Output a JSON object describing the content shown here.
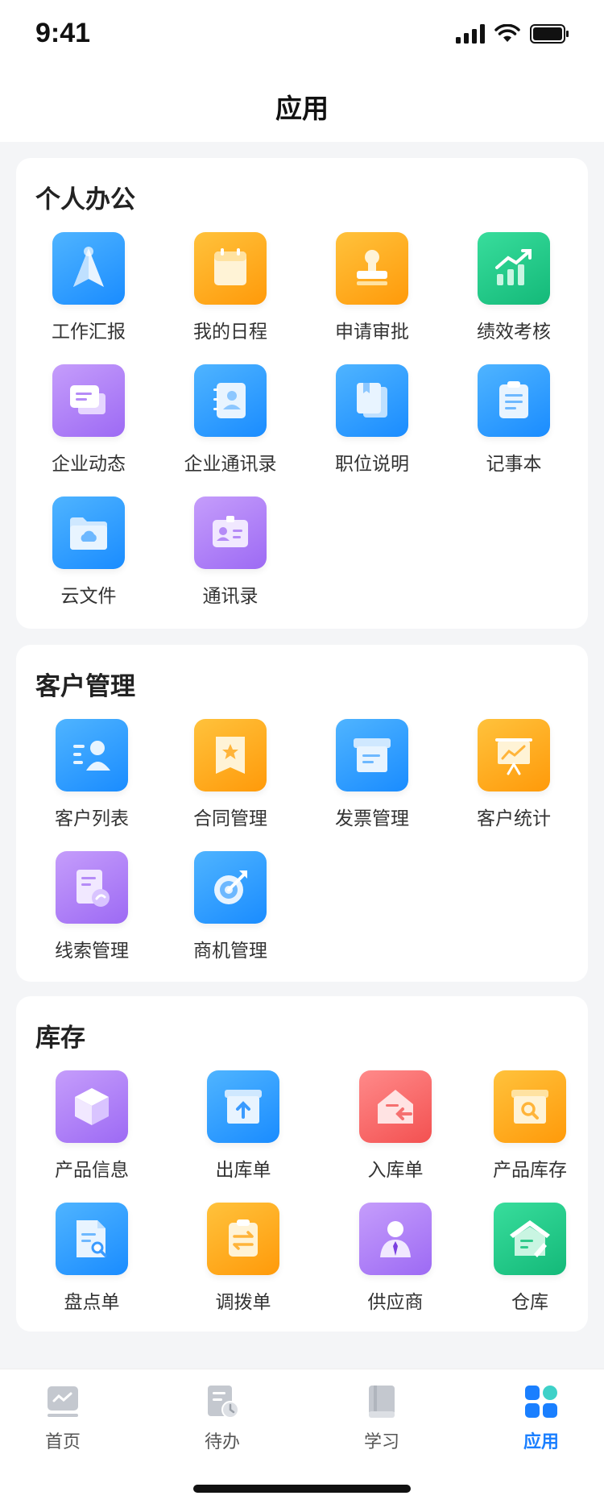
{
  "status": {
    "time": "9:41"
  },
  "nav": {
    "title": "应用"
  },
  "sections": [
    {
      "title": "个人办公",
      "items": [
        {
          "label": "工作汇报",
          "icon": "paper-plane-icon",
          "color": "blue"
        },
        {
          "label": "我的日程",
          "icon": "calendar-icon",
          "color": "orange"
        },
        {
          "label": "申请审批",
          "icon": "stamp-icon",
          "color": "orange"
        },
        {
          "label": "绩效考核",
          "icon": "growth-chart-icon",
          "color": "green"
        },
        {
          "label": "企业动态",
          "icon": "message-icon",
          "color": "purple"
        },
        {
          "label": "企业通讯录",
          "icon": "contact-book-icon",
          "color": "blue"
        },
        {
          "label": "职位说明",
          "icon": "document-icon",
          "color": "blue"
        },
        {
          "label": "记事本",
          "icon": "clipboard-icon",
          "color": "blue"
        },
        {
          "label": "云文件",
          "icon": "cloud-folder-icon",
          "color": "blue"
        },
        {
          "label": "通讯录",
          "icon": "id-card-icon",
          "color": "purple"
        }
      ]
    },
    {
      "title": "客户管理",
      "items": [
        {
          "label": "客户列表",
          "icon": "customer-list-icon",
          "color": "blue"
        },
        {
          "label": "合同管理",
          "icon": "contract-icon",
          "color": "orange"
        },
        {
          "label": "发票管理",
          "icon": "invoice-icon",
          "color": "blue"
        },
        {
          "label": "客户统计",
          "icon": "presentation-chart-icon",
          "color": "orange"
        },
        {
          "label": "线索管理",
          "icon": "lead-icon",
          "color": "purple"
        },
        {
          "label": "商机管理",
          "icon": "target-icon",
          "color": "blue"
        }
      ]
    },
    {
      "title": "库存",
      "items": [
        {
          "label": "产品信息",
          "icon": "box-icon",
          "color": "purple"
        },
        {
          "label": "出库单",
          "icon": "outbound-icon",
          "color": "blue"
        },
        {
          "label": "入库单",
          "icon": "inbound-icon",
          "color": "red"
        },
        {
          "label": "产品库存",
          "icon": "inventory-search-icon",
          "color": "orange"
        },
        {
          "label": "盘点单",
          "icon": "stocktake-icon",
          "color": "blue"
        },
        {
          "label": "调拨单",
          "icon": "transfer-icon",
          "color": "orange"
        },
        {
          "label": "供应商",
          "icon": "supplier-icon",
          "color": "purple"
        },
        {
          "label": "仓库",
          "icon": "warehouse-icon",
          "color": "green"
        }
      ]
    }
  ],
  "tabs": [
    {
      "label": "首页",
      "icon": "home-chart-icon",
      "active": false
    },
    {
      "label": "待办",
      "icon": "todo-icon",
      "active": false
    },
    {
      "label": "学习",
      "icon": "book-icon",
      "active": false
    },
    {
      "label": "应用",
      "icon": "apps-grid-icon",
      "active": true
    }
  ],
  "colors": {
    "accent": "#1a7fff",
    "page_bg": "#f4f5f7"
  }
}
